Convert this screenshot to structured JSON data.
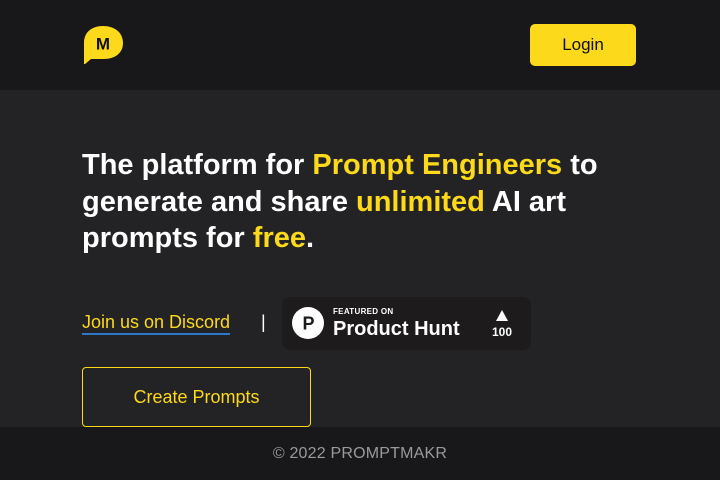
{
  "header": {
    "logo_letter": "M",
    "login_label": "Login"
  },
  "hero": {
    "headline": {
      "part1": "The platform for ",
      "highlight1": "Prompt Engineers",
      "part2": " to generate and share ",
      "highlight2": "unlimited",
      "part3": " AI art prompts for ",
      "highlight3": "free",
      "part4": "."
    },
    "discord_label": "Join us on Discord",
    "separator": "|",
    "product_hunt": {
      "featured_label": "FEATURED ON",
      "name": "Product Hunt",
      "upvotes": "100",
      "logo_letter": "P"
    },
    "create_label": "Create Prompts"
  },
  "footer": {
    "copyright": "© 2022 PROMPTMAKR"
  },
  "icons": {
    "logo": "promptmakr-logo-icon",
    "product_hunt_logo": "product-hunt-logo-icon",
    "upvote": "upvote-triangle-icon"
  },
  "colors": {
    "accent": "#fcd91a",
    "header_bg": "#18181a",
    "main_bg": "#232326",
    "link_underline": "#2f78c8"
  }
}
